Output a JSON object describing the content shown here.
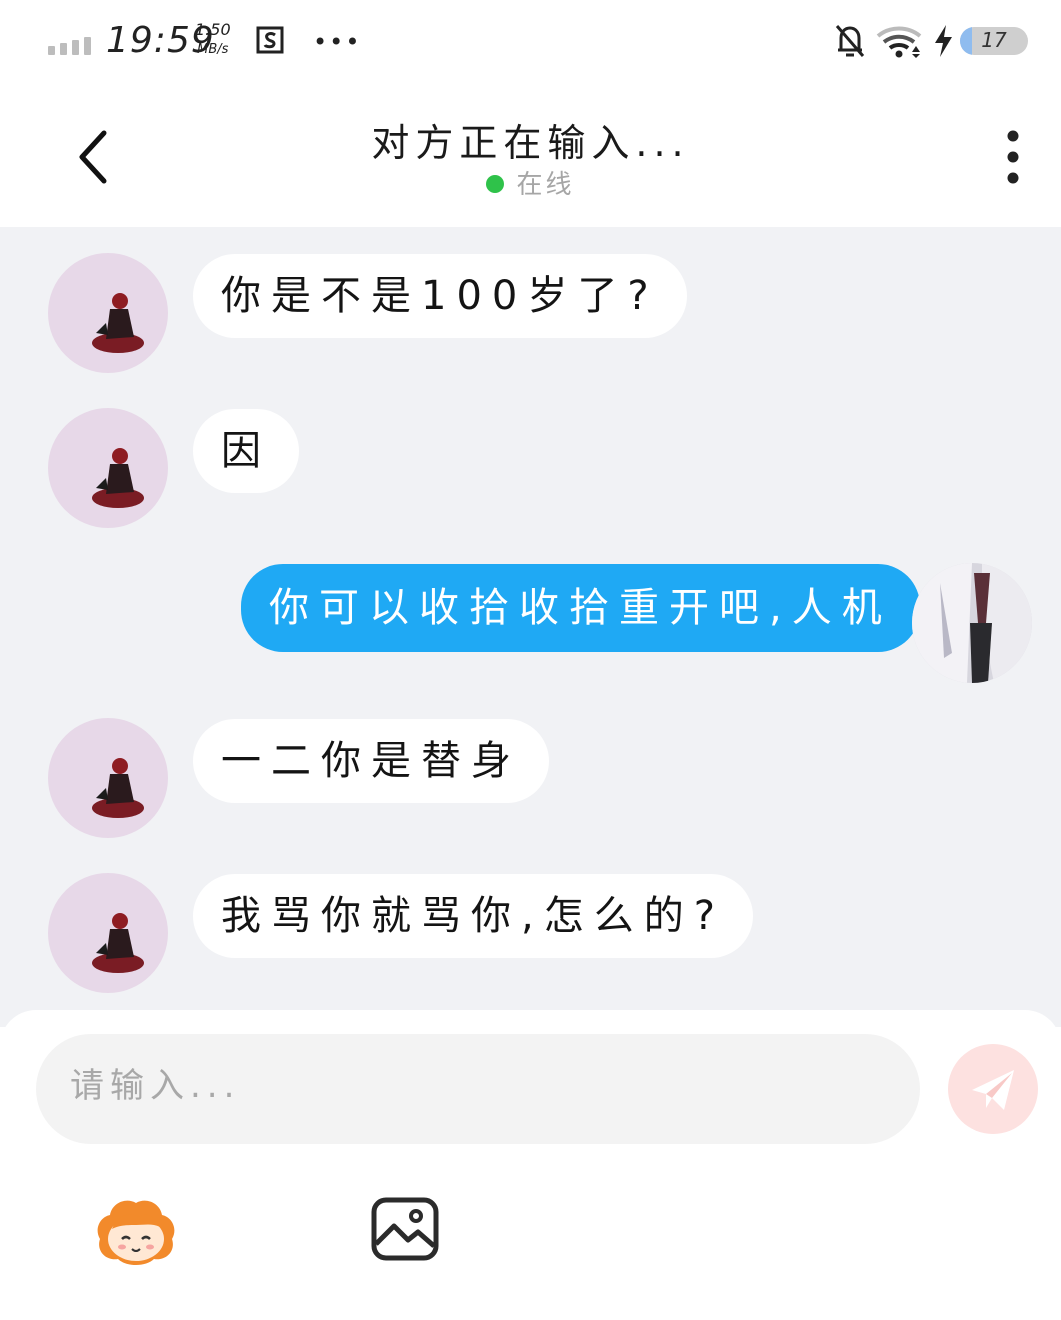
{
  "status_bar": {
    "time": "19:59",
    "net_speed_value": "1.50",
    "net_speed_unit": "MB/s",
    "more": "•••",
    "battery_percent": "17",
    "icons": [
      "signal-icon",
      "screenshot-icon",
      "more-icon",
      "bell-off-icon",
      "wifi-icon",
      "charging-icon",
      "battery-icon"
    ]
  },
  "header": {
    "title": "对方正在输入...",
    "status_text": "在线",
    "status_color": "#2fc24a",
    "icons": [
      "back-arrow-icon",
      "more-vertical-icon"
    ]
  },
  "messages": [
    {
      "side": "left",
      "text": "你是不是100岁了?"
    },
    {
      "side": "left",
      "text": "因"
    },
    {
      "side": "right",
      "text": "你可以收拾收拾重开吧,人机"
    },
    {
      "side": "left",
      "text": "一二你是替身"
    },
    {
      "side": "left",
      "text": "我骂你就骂你,怎么的?"
    }
  ],
  "colors": {
    "chat_background": "#f1f2f5",
    "outgoing_bubble": "#1fa9f4",
    "incoming_bubble": "#ffffff",
    "send_button": "#fde1e0"
  },
  "input": {
    "placeholder": "请输入...",
    "value": ""
  },
  "toolbar": {
    "icons": [
      "send-icon",
      "emoji-sticker-icon",
      "image-icon"
    ]
  }
}
